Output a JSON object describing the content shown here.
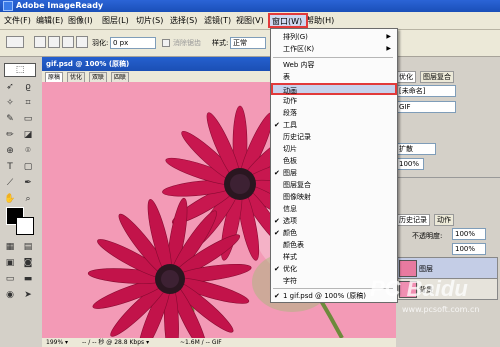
{
  "title_bar": {
    "title": "Adobe ImageReady"
  },
  "menubar": {
    "items": [
      "文件(F)",
      "编辑(E)",
      "图像(I)",
      "图层(L)",
      "切片(S)",
      "选择(S)",
      "滤镜(T)",
      "视图(V)",
      "窗口(W)",
      "帮助(H)"
    ]
  },
  "optionsbar": {
    "feather_label": "羽化:",
    "feather_value": "0 px",
    "antialias_label": "消除锯齿",
    "style_label": "样式:",
    "style_value": "正常"
  },
  "document": {
    "title": "gif.psd @ 100% (原稿)",
    "tabs": [
      "原稿",
      "优化",
      "双联",
      "四联"
    ],
    "status": {
      "zoom": "199% ▾",
      "download": "-- / -- 秒 @ 28.8 Kbps ▾",
      "format": "~1.6M / -- GIF"
    }
  },
  "right_panel": {
    "tabs_top": [
      "优化",
      "图层复合"
    ],
    "preset_value": "[未命名]",
    "format_value": "GIF",
    "dither_value": "扩散",
    "percent_value": "100%",
    "tabs_bottom": [
      "历史记录",
      "动作"
    ],
    "opacity_label": "不透明度:",
    "opacity_value": "100%",
    "fill_value": "100%",
    "layer_name": "图层",
    "background_name": "背景"
  },
  "window_menu": {
    "items": [
      {
        "label": "排列(G)",
        "submenu": true,
        "checked": false
      },
      {
        "label": "工作区(K)",
        "submenu": true,
        "checked": false
      },
      {
        "label": "Web 内容",
        "submenu": false,
        "checked": false
      },
      {
        "label": "表",
        "submenu": false,
        "checked": false
      },
      {
        "label": "动画",
        "submenu": false,
        "checked": false,
        "highlighted": true
      },
      {
        "label": "动作",
        "submenu": false,
        "checked": false
      },
      {
        "label": "段落",
        "submenu": false,
        "checked": false
      },
      {
        "label": "工具",
        "submenu": false,
        "checked": true
      },
      {
        "label": "历史记录",
        "submenu": false,
        "checked": false
      },
      {
        "label": "切片",
        "submenu": false,
        "checked": false
      },
      {
        "label": "色板",
        "submenu": false,
        "checked": false
      },
      {
        "label": "图层",
        "submenu": false,
        "checked": true
      },
      {
        "label": "图层复合",
        "submenu": false,
        "checked": false
      },
      {
        "label": "图像映射",
        "submenu": false,
        "checked": false
      },
      {
        "label": "信息",
        "submenu": false,
        "checked": false
      },
      {
        "label": "选项",
        "submenu": false,
        "checked": true
      },
      {
        "label": "颜色",
        "submenu": false,
        "checked": true
      },
      {
        "label": "颜色表",
        "submenu": false,
        "checked": false
      },
      {
        "label": "样式",
        "submenu": false,
        "checked": false
      },
      {
        "label": "优化",
        "submenu": false,
        "checked": true
      },
      {
        "label": "字符",
        "submenu": false,
        "checked": false
      },
      {
        "label": "1 gif.psd @ 100% (原稿)",
        "submenu": false,
        "checked": true
      }
    ]
  },
  "watermark": {
    "text": "PC Baidu",
    "sub": "www.pcsoft.com.cn"
  }
}
